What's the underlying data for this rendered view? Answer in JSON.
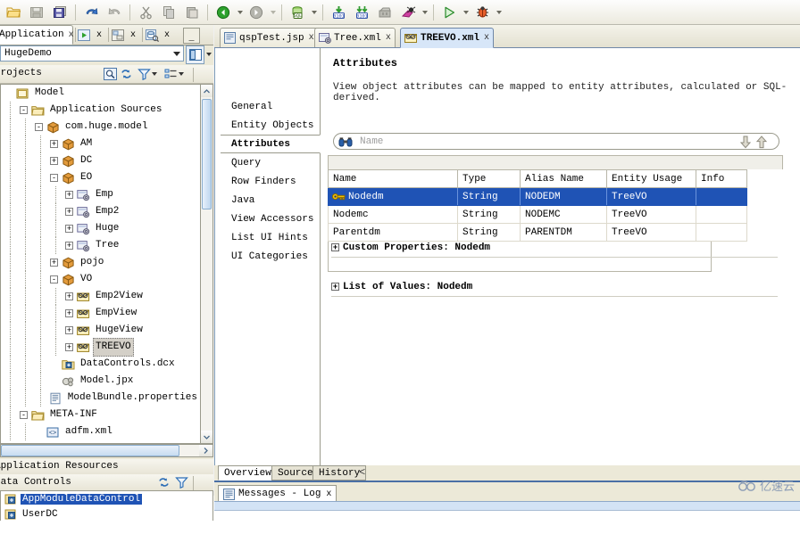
{
  "toolbar": {
    "buttons": [
      {
        "name": "open-file",
        "label": "Open",
        "enabled": true
      },
      {
        "name": "save",
        "label": "Save",
        "enabled": false
      },
      {
        "name": "save-all",
        "label": "Save All",
        "enabled": true
      },
      {
        "name": "undo",
        "label": "Undo",
        "enabled": true
      },
      {
        "name": "redo",
        "label": "Redo",
        "enabled": false
      },
      {
        "name": "cut",
        "label": "Cut",
        "enabled": false
      },
      {
        "name": "copy",
        "label": "Copy",
        "enabled": false
      },
      {
        "name": "paste",
        "label": "Paste",
        "enabled": false
      },
      {
        "name": "back",
        "label": "Back",
        "enabled": true
      },
      {
        "name": "forward",
        "label": "Forward",
        "enabled": true
      },
      {
        "name": "sql-worksheet",
        "label": "SQL Worksheet",
        "enabled": true
      },
      {
        "name": "step-into",
        "label": "Step Into",
        "enabled": true
      },
      {
        "name": "step-over",
        "label": "Step Over",
        "enabled": true
      },
      {
        "name": "build",
        "label": "Make",
        "enabled": false
      },
      {
        "name": "rebuild",
        "label": "Rebuild",
        "enabled": true
      },
      {
        "name": "run",
        "label": "Run",
        "enabled": true
      },
      {
        "name": "debug",
        "label": "Debug",
        "enabled": true
      }
    ]
  },
  "left_dock": {
    "tabs": [
      {
        "label": "Application",
        "close": "x",
        "active": true
      },
      {
        "label": "",
        "icon": "run-manager-icon",
        "close": "x",
        "active": false
      },
      {
        "label": "",
        "icon": "structure-icon",
        "close": "x",
        "active": false
      },
      {
        "label": "",
        "icon": "database-icon",
        "close": "x",
        "active": false
      }
    ],
    "minimize_label": "_",
    "application_selector": {
      "value": "HugeDemo",
      "arrow": "chevron-down-icon"
    },
    "toolbar_icons": [
      "window-layout-icon",
      "layout-dropdown-icon"
    ],
    "projects_header": {
      "title": "Projects",
      "icons": [
        "search-icon",
        "refresh-icon",
        "filter-icon",
        "filter-dropdown-icon",
        "group-icon",
        "group-dropdown-icon"
      ]
    },
    "tree": [
      {
        "indent": 0,
        "expander": "",
        "icon": "project-icon",
        "label": "Model",
        "selected": false
      },
      {
        "indent": 1,
        "expander": "-",
        "icon": "folder-icon",
        "label": "Application Sources",
        "selected": false
      },
      {
        "indent": 2,
        "expander": "-",
        "icon": "package-icon",
        "label": "com.huge.model",
        "selected": false
      },
      {
        "indent": 3,
        "expander": "+",
        "icon": "package-icon",
        "label": "AM",
        "selected": false
      },
      {
        "indent": 3,
        "expander": "+",
        "icon": "package-icon",
        "label": "DC",
        "selected": false
      },
      {
        "indent": 3,
        "expander": "-",
        "icon": "package-icon",
        "label": "EO",
        "selected": false
      },
      {
        "indent": 4,
        "expander": "+",
        "icon": "entity-object-icon",
        "label": "Emp",
        "selected": false
      },
      {
        "indent": 4,
        "expander": "+",
        "icon": "entity-object-icon",
        "label": "Emp2",
        "selected": false
      },
      {
        "indent": 4,
        "expander": "+",
        "icon": "entity-object-icon",
        "label": "Huge",
        "selected": false
      },
      {
        "indent": 4,
        "expander": "+",
        "icon": "entity-object-icon",
        "label": "Tree",
        "selected": false
      },
      {
        "indent": 3,
        "expander": "+",
        "icon": "package-icon",
        "label": "pojo",
        "selected": false
      },
      {
        "indent": 3,
        "expander": "-",
        "icon": "package-icon",
        "label": "VO",
        "selected": false
      },
      {
        "indent": 4,
        "expander": "+",
        "icon": "view-object-icon",
        "label": "Emp2View",
        "selected": false
      },
      {
        "indent": 4,
        "expander": "+",
        "icon": "view-object-icon",
        "label": "EmpView",
        "selected": false
      },
      {
        "indent": 4,
        "expander": "+",
        "icon": "view-object-icon",
        "label": "HugeView",
        "selected": false
      },
      {
        "indent": 4,
        "expander": "+",
        "icon": "view-object-icon",
        "label": "TREEVO",
        "selected": true
      },
      {
        "indent": 3,
        "expander": "",
        "icon": "data-controls-icon",
        "label": "DataControls.dcx",
        "selected": false
      },
      {
        "indent": 3,
        "expander": "",
        "icon": "jpx-icon",
        "label": "Model.jpx",
        "selected": false
      },
      {
        "indent": 3,
        "expander": "",
        "icon": "properties-icon",
        "label": "ModelBundle.properties",
        "selected": false
      },
      {
        "indent": 1,
        "expander": "-",
        "icon": "folder-icon",
        "label": "META-INF",
        "selected": false
      },
      {
        "indent": 2,
        "expander": "",
        "icon": "xml-icon",
        "label": "adfm.xml",
        "selected": false
      }
    ],
    "resources_header": "Application Resources",
    "data_controls_header": "Data Controls",
    "data_controls_icons": [
      "refresh-icon",
      "filter-icon"
    ],
    "data_controls": [
      {
        "label": "AppModuleDataControl",
        "icon": "data-control-icon",
        "selected": true
      },
      {
        "label": "UserDC",
        "icon": "data-control-icon",
        "selected": false
      }
    ]
  },
  "editor": {
    "tabs": [
      {
        "label": "qspTest.jsp",
        "icon": "jsp-icon",
        "close": "x",
        "active": false
      },
      {
        "label": "Tree.xml",
        "icon": "entity-object-icon",
        "close": "x",
        "active": false
      },
      {
        "label": "TREEVO.xml",
        "icon": "view-object-icon",
        "close": "x",
        "active": true
      }
    ],
    "side_nav": [
      {
        "label": "General",
        "active": false
      },
      {
        "label": "Entity Objects",
        "active": false
      },
      {
        "label": "Attributes",
        "active": true
      },
      {
        "label": "Query",
        "active": false
      },
      {
        "label": "Row Finders",
        "active": false
      },
      {
        "label": "Java",
        "active": false
      },
      {
        "label": "View Accessors",
        "active": false
      },
      {
        "label": "List UI Hints",
        "active": false
      },
      {
        "label": "UI Categories",
        "active": false
      }
    ],
    "section_title": "Attributes",
    "section_description": "View object attributes can be mapped to entity attributes, calculated or SQL-derived.",
    "search": {
      "placeholder": "Name",
      "value": "",
      "icon": "binoculars-icon",
      "buttons": [
        "arrow-down-icon",
        "arrow-up-icon"
      ]
    },
    "table": {
      "columns": [
        "Name",
        "Type",
        "Alias Name",
        "Entity Usage",
        "Info"
      ],
      "rows": [
        {
          "name": "Nodedm",
          "type": "String",
          "alias": "NODEDM",
          "usage": "TreeVO",
          "info": "",
          "key": true,
          "selected": true
        },
        {
          "name": "Nodemc",
          "type": "String",
          "alias": "NODEMC",
          "usage": "TreeVO",
          "info": "",
          "key": false,
          "selected": false
        },
        {
          "name": "Parentdm",
          "type": "String",
          "alias": "PARENTDM",
          "usage": "TreeVO",
          "info": "",
          "key": false,
          "selected": false
        }
      ]
    },
    "collapsers": [
      {
        "expander": "+",
        "label": "Custom Properties: Nodedm"
      },
      {
        "expander": "+",
        "label": "List of Values: Nodedm"
      }
    ],
    "bottom_tabs": [
      {
        "label": "Overview",
        "active": true
      },
      {
        "label": "Source",
        "active": false
      },
      {
        "label": "History",
        "active": false
      }
    ],
    "bottom_tab_scroll": "<"
  },
  "log_panel": {
    "tab_label": "Messages - Log",
    "close": "x",
    "icon": "log-icon"
  },
  "watermark": {
    "text": "亿速云",
    "icon": "cloud-icon"
  },
  "colors": {
    "selection": "#1f53b5",
    "active_tab": "#d7e6f8",
    "chrome": "#ece9d8"
  }
}
